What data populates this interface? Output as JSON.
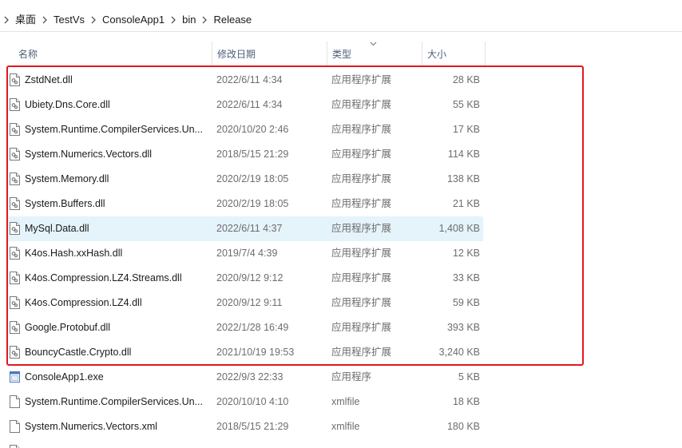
{
  "breadcrumb": [
    "桌面",
    "TestVs",
    "ConsoleApp1",
    "bin",
    "Release"
  ],
  "columns": {
    "name": "名称",
    "date": "修改日期",
    "type": "类型",
    "size": "大小"
  },
  "files": [
    {
      "name": "ZstdNet.dll",
      "date": "2022/6/11 4:34",
      "type": "应用程序扩展",
      "size": "28 KB",
      "icon": "dll-file-icon"
    },
    {
      "name": "Ubiety.Dns.Core.dll",
      "date": "2022/6/11 4:34",
      "type": "应用程序扩展",
      "size": "55 KB",
      "icon": "dll-file-icon"
    },
    {
      "name": "System.Runtime.CompilerServices.Un...",
      "date": "2020/10/20 2:46",
      "type": "应用程序扩展",
      "size": "17 KB",
      "icon": "dll-file-icon"
    },
    {
      "name": "System.Numerics.Vectors.dll",
      "date": "2018/5/15 21:29",
      "type": "应用程序扩展",
      "size": "114 KB",
      "icon": "dll-file-icon"
    },
    {
      "name": "System.Memory.dll",
      "date": "2020/2/19 18:05",
      "type": "应用程序扩展",
      "size": "138 KB",
      "icon": "dll-file-icon"
    },
    {
      "name": "System.Buffers.dll",
      "date": "2020/2/19 18:05",
      "type": "应用程序扩展",
      "size": "21 KB",
      "icon": "dll-file-icon"
    },
    {
      "name": "MySql.Data.dll",
      "date": "2022/6/11 4:37",
      "type": "应用程序扩展",
      "size": "1,408 KB",
      "icon": "dll-file-icon"
    },
    {
      "name": "K4os.Hash.xxHash.dll",
      "date": "2019/7/4 4:39",
      "type": "应用程序扩展",
      "size": "12 KB",
      "icon": "dll-file-icon"
    },
    {
      "name": "K4os.Compression.LZ4.Streams.dll",
      "date": "2020/9/12 9:12",
      "type": "应用程序扩展",
      "size": "33 KB",
      "icon": "dll-file-icon"
    },
    {
      "name": "K4os.Compression.LZ4.dll",
      "date": "2020/9/12 9:11",
      "type": "应用程序扩展",
      "size": "59 KB",
      "icon": "dll-file-icon"
    },
    {
      "name": "Google.Protobuf.dll",
      "date": "2022/1/28 16:49",
      "type": "应用程序扩展",
      "size": "393 KB",
      "icon": "dll-file-icon"
    },
    {
      "name": "BouncyCastle.Crypto.dll",
      "date": "2021/10/19 19:53",
      "type": "应用程序扩展",
      "size": "3,240 KB",
      "icon": "dll-file-icon"
    },
    {
      "name": "ConsoleApp1.exe",
      "date": "2022/9/3 22:33",
      "type": "应用程序",
      "size": "5 KB",
      "icon": "exe-file-icon"
    },
    {
      "name": "System.Runtime.CompilerServices.Un...",
      "date": "2020/10/10 4:10",
      "type": "xmlfile",
      "size": "18 KB",
      "icon": "xml-file-icon"
    },
    {
      "name": "System.Numerics.Vectors.xml",
      "date": "2018/5/15 21:29",
      "type": "xmlfile",
      "size": "180 KB",
      "icon": "xml-file-icon"
    },
    {
      "name": "",
      "date": "",
      "type": "",
      "size": "",
      "icon": "xml-file-icon"
    }
  ],
  "hovered_row": "MySql.Data.dll",
  "colors": {
    "highlight_border": "#e0191f",
    "hover_background": "#e5f3fb",
    "header_text": "#4c607a"
  }
}
